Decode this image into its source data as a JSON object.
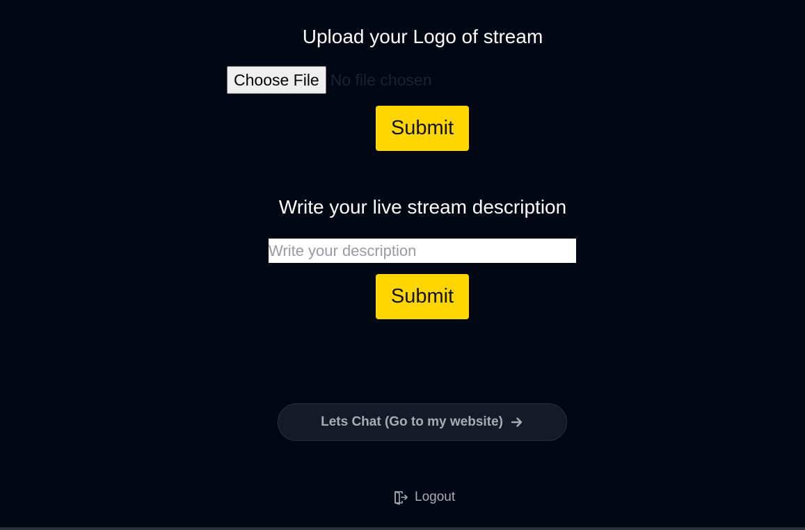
{
  "logo_section": {
    "heading": "Upload your Logo of stream",
    "choose_file_label": "Choose File",
    "file_status": "No file chosen",
    "submit_label": "Submit"
  },
  "description_section": {
    "heading": "Write your live stream description",
    "input_placeholder": "Write your description",
    "input_value": "",
    "submit_label": "Submit"
  },
  "chat_button": {
    "label": "Lets Chat (Go to my website)",
    "icon": "arrow-right-icon"
  },
  "logout": {
    "label": "Logout",
    "icon": "logout-icon"
  },
  "colors": {
    "background": "#010814",
    "accent": "#ffd600",
    "muted_text": "#a8acb3"
  }
}
